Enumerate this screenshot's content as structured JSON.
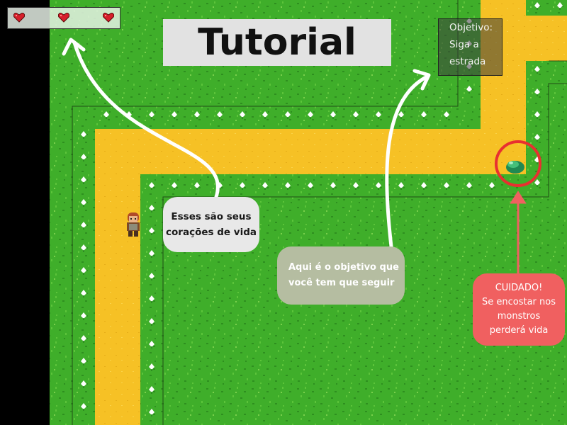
{
  "game": {
    "hud": {
      "hearts": [
        {
          "icon": "heart-icon",
          "color": "#d61f2b"
        },
        {
          "icon": "heart-icon",
          "color": "#d61f2b"
        },
        {
          "icon": "heart-icon",
          "color": "#d61f2b"
        }
      ]
    },
    "title": "Tutorial",
    "objective": {
      "label": "Objetivo:",
      "line1": "Siga a",
      "line2": "estrada"
    },
    "callouts": {
      "hearts": "Esses são seus\ncorações de vida",
      "objective": "Aqui é o objetivo que\nvocê tem que seguir",
      "warning": "CUIDADO!\nSe encostar nos\nmonstros\nperderá vida"
    },
    "colors": {
      "grass": "#3fae2a",
      "road": "#f6c125",
      "warning": "#f06060",
      "arrow": "#ffffff",
      "highlight_ring": "#e83030"
    }
  }
}
